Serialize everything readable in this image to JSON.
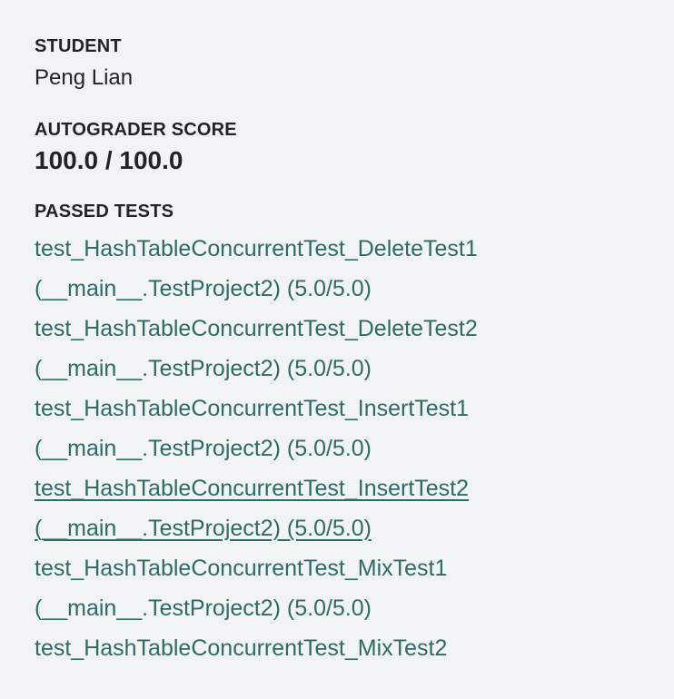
{
  "student": {
    "label": "STUDENT",
    "name": "Peng Lian"
  },
  "autograder": {
    "label": "AUTOGRADER SCORE",
    "score": "100.0 / 100.0"
  },
  "passed_tests": {
    "label": "PASSED TESTS",
    "items": [
      {
        "line1": "test_HashTableConcurrentTest_DeleteTest1",
        "line2": "(__main__.TestProject2) (5.0/5.0)"
      },
      {
        "line1": "test_HashTableConcurrentTest_DeleteTest2",
        "line2": "(__main__.TestProject2) (5.0/5.0)"
      },
      {
        "line1": "test_HashTableConcurrentTest_InsertTest1",
        "line2": "(__main__.TestProject2) (5.0/5.0)"
      },
      {
        "line1": "test_HashTableConcurrentTest_InsertTest2",
        "line2": "(__main__.TestProject2) (5.0/5.0)"
      },
      {
        "line1": "test_HashTableConcurrentTest_MixTest1",
        "line2": "(__main__.TestProject2) (5.0/5.0)"
      },
      {
        "line1": "test_HashTableConcurrentTest_MixTest2",
        "line2": ""
      }
    ]
  },
  "colors": {
    "background": "#f1f3f5",
    "text": "#1f2527",
    "link": "#2f6b66"
  }
}
